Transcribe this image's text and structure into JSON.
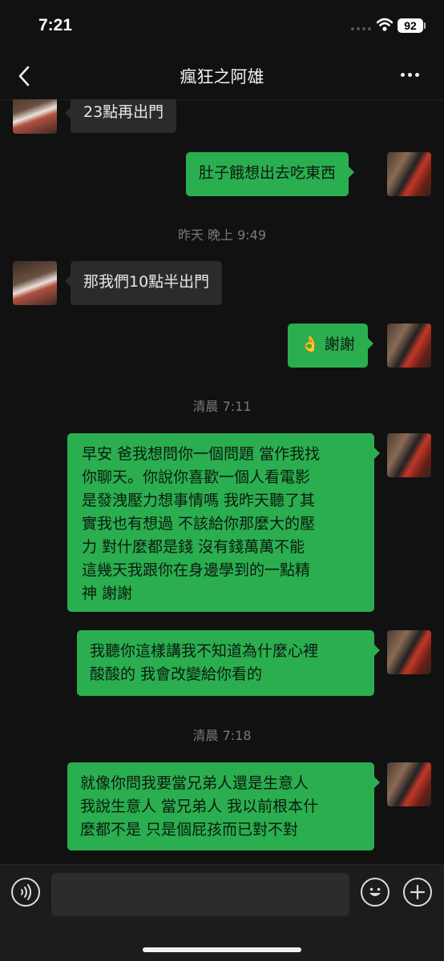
{
  "status_bar": {
    "time": "7:21",
    "battery": "92"
  },
  "header": {
    "title": "瘋狂之阿雄",
    "back_icon": "chevron-left-icon",
    "more_icon": "more-dots-icon"
  },
  "messages": [
    {
      "side": "in",
      "text": "23點再出門"
    },
    {
      "side": "out",
      "text": "肚子餓想出去吃東西"
    },
    {
      "timestamp": "昨天 晚上 9:49"
    },
    {
      "side": "in",
      "text": "那我們10點半出門"
    },
    {
      "side": "out",
      "text": "👌 謝謝"
    },
    {
      "timestamp": "清晨 7:11"
    },
    {
      "side": "out",
      "lines": [
        "早安 爸我想問你一個問題 當作我找",
        "你聊天。你說你喜歡一個人看電影",
        "是發洩壓力想事情嗎 我昨天聽了其",
        "實我也有想過 不該給你那麼大的壓",
        "力 對什麼都是錢 沒有錢萬萬不能",
        "這幾天我跟你在身邊學到的一點精",
        "神 謝謝"
      ]
    },
    {
      "side": "out",
      "lines": [
        "我聽你這樣講我不知道為什麼心裡",
        "酸酸的 我會改變給你看的"
      ]
    },
    {
      "timestamp": "清晨 7:18"
    },
    {
      "side": "out",
      "lines": [
        "就像你問我要當兄弟人還是生意人",
        "我說生意人 當兄弟人 我以前根本什",
        "麼都不是 只是個屁孩而已對不對"
      ]
    }
  ],
  "input_bar": {
    "text": "",
    "voice_icon": "voice-icon",
    "emoji_icon": "emoji-icon",
    "plus_icon": "plus-icon"
  },
  "colors": {
    "background": "#111111",
    "outgoing_bubble": "#2aae4f",
    "incoming_bubble": "#2b2b2b"
  }
}
